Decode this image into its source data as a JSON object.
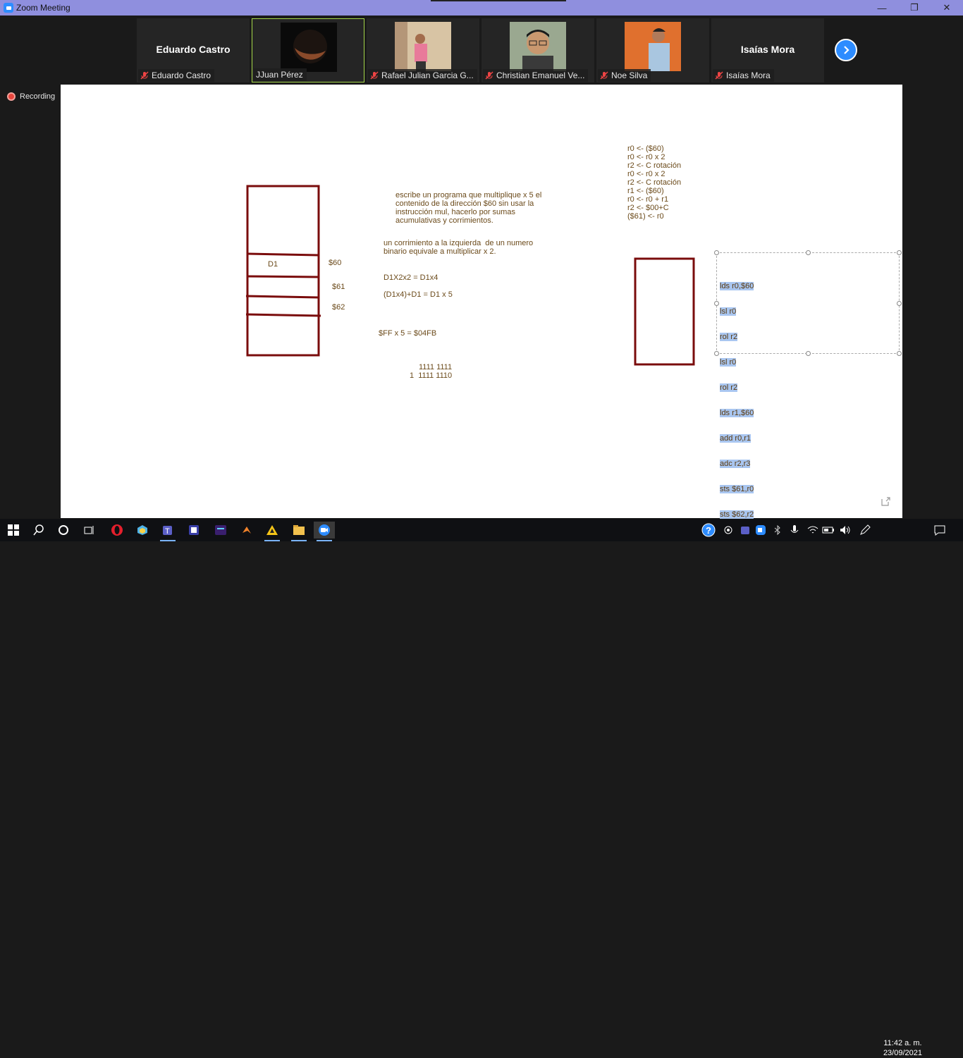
{
  "window": {
    "title": "Zoom Meeting"
  },
  "participants": [
    {
      "display_name": "Eduardo Castro",
      "label": "Eduardo Castro",
      "muted": true,
      "video": false
    },
    {
      "display_name": "",
      "label": "JJuan Pérez",
      "muted": false,
      "video": true,
      "active_speaker": true
    },
    {
      "display_name": "",
      "label": "Rafael Julian Garcia G...",
      "muted": true,
      "video": true
    },
    {
      "display_name": "",
      "label": "Christian Emanuel Ve...",
      "muted": true,
      "video": true
    },
    {
      "display_name": "",
      "label": "Noe Silva",
      "muted": true,
      "video": true
    },
    {
      "display_name": "Isaías Mora",
      "label": "Isaías Mora",
      "muted": true,
      "video": false
    }
  ],
  "recording": {
    "label": "Recording"
  },
  "whiteboard": {
    "memory_labels": {
      "d1": "D1",
      "addr60": "$60",
      "addr61": "$61",
      "addr62": "$62"
    },
    "task_text": "escribe un programa que multiplique x 5 el\ncontenido de la dirección $60 sin usar la\ninstrucción mul, hacerlo por sumas\nacumulativas y corrimientos.",
    "shift_text": "un corrimiento a la izquierda  de un numero\nbinario equivale a multiplicar x 2.",
    "eq1": "D1X2x2 = D1x4",
    "eq2": "(D1x4)+D1 = D1 x 5",
    "eq3": "$FF x 5 = $04FB",
    "bin1": "1111 1111",
    "bin2": "1  1111 1110",
    "pseudocode": "r0 <- ($60)\nr0 <- r0 x 2\nr2 <- C rotación\nr0 <- r0 x 2\nr2 <- C rotación\nr1 <- ($60)\nr0 <- r0 + r1\nr2 <- $00+C\n($61) <- r0",
    "code_lines": [
      "lds r0,$60",
      "lsl r0",
      "rol r2",
      "lsl r0",
      "rol r2",
      "lds r1,$60",
      "add r0,r1",
      "adc r2,r3",
      "sts $61,r0",
      "sts $62,r2"
    ]
  },
  "taskbar": {
    "clock_time": "11:42 a. m.",
    "clock_date": "23/09/2021"
  },
  "colors": {
    "title_bar": "#8f8fde",
    "zoom_blue": "#2d8cff",
    "drawing_red": "#7a0c0c",
    "text_brown": "#6b4a1a",
    "selection": "#a9c6f0"
  }
}
